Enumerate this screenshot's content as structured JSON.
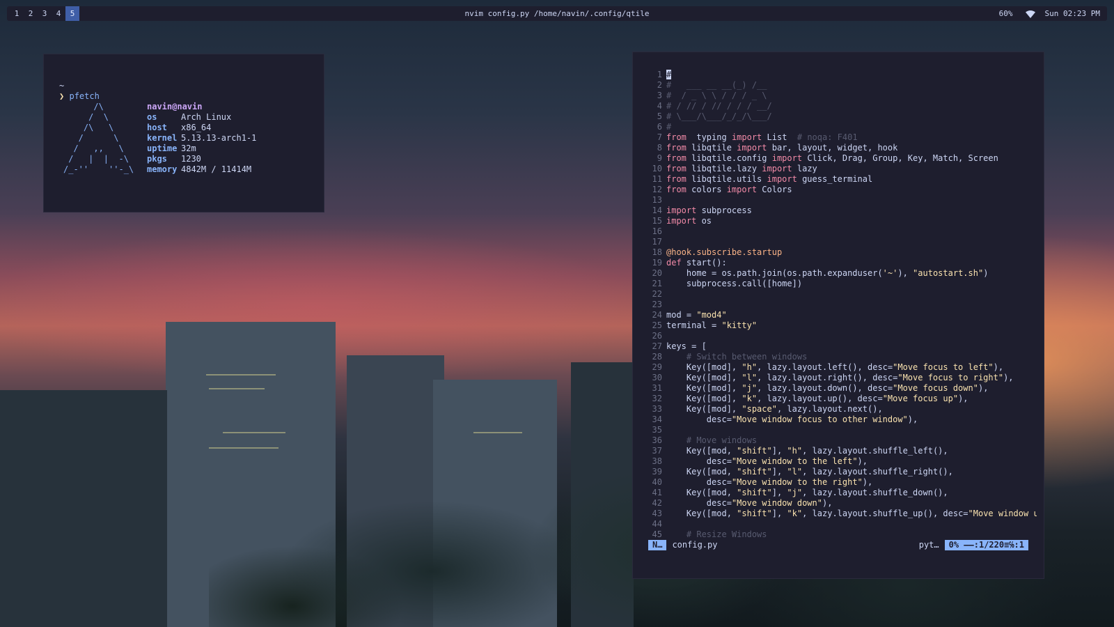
{
  "topbar": {
    "groups": [
      "1",
      "2",
      "3",
      "4",
      "5"
    ],
    "active_group": "5",
    "window_title": "nvim config.py /home/navin/.config/qtile",
    "battery": "60%",
    "clock": "Sun 02:23 PM"
  },
  "terminal": {
    "tilde": "~",
    "prompt_symbol": "❯",
    "command": "pfetch",
    "logo": "      /\\\n     /  \\\n    /\\   \\\n   /      \\\n  /   ,,   \\\n /   |  |  -\\\n/_-''    ''-_\\",
    "user": "navin@navin",
    "info": [
      {
        "key": "os",
        "value": "Arch Linux"
      },
      {
        "key": "host",
        "value": "x86_64"
      },
      {
        "key": "kernel",
        "value": "5.13.13-arch1-1"
      },
      {
        "key": "uptime",
        "value": "32m"
      },
      {
        "key": "pkgs",
        "value": "1230"
      },
      {
        "key": "memory",
        "value": "4842M / 11414M"
      }
    ]
  },
  "editor": {
    "lines": [
      {
        "n": "1",
        "p": [
          [
            "cursor",
            "#"
          ]
        ]
      },
      {
        "n": "2",
        "p": [
          [
            "cm",
            "#   ___ __ __(_) /__"
          ]
        ]
      },
      {
        "n": "3",
        "p": [
          [
            "cm",
            "#  / _ \\ \\ / / / _ \\"
          ]
        ]
      },
      {
        "n": "4",
        "p": [
          [
            "cm",
            "# / // / // / / / __/"
          ]
        ]
      },
      {
        "n": "5",
        "p": [
          [
            "cm",
            "# \\___/\\___/_/_/\\___/"
          ]
        ]
      },
      {
        "n": "6",
        "p": [
          [
            "cm",
            "#"
          ]
        ]
      },
      {
        "n": "7",
        "p": [
          [
            "kw",
            "from"
          ],
          [
            "",
            "  typing "
          ],
          [
            "kw",
            "import"
          ],
          [
            "",
            " List  "
          ],
          [
            "cm",
            "# noqa: F401"
          ]
        ]
      },
      {
        "n": "8",
        "p": [
          [
            "kw",
            "from"
          ],
          [
            "",
            " libqtile "
          ],
          [
            "kw",
            "import"
          ],
          [
            "",
            " bar, layout, widget, hook"
          ]
        ]
      },
      {
        "n": "9",
        "p": [
          [
            "kw",
            "from"
          ],
          [
            "",
            " libqtile.config "
          ],
          [
            "kw",
            "import"
          ],
          [
            "",
            " Click, Drag, Group, Key, Match, Screen"
          ]
        ]
      },
      {
        "n": "10",
        "p": [
          [
            "kw",
            "from"
          ],
          [
            "",
            " libqtile.lazy "
          ],
          [
            "kw",
            "import"
          ],
          [
            "",
            " lazy"
          ]
        ]
      },
      {
        "n": "11",
        "p": [
          [
            "kw",
            "from"
          ],
          [
            "",
            " libqtile.utils "
          ],
          [
            "kw",
            "import"
          ],
          [
            "",
            " guess_terminal"
          ]
        ]
      },
      {
        "n": "12",
        "p": [
          [
            "kw",
            "from"
          ],
          [
            "",
            " colors "
          ],
          [
            "kw",
            "import"
          ],
          [
            "",
            " Colors"
          ]
        ]
      },
      {
        "n": "13",
        "p": []
      },
      {
        "n": "14",
        "p": [
          [
            "kw",
            "import"
          ],
          [
            "",
            " subprocess"
          ]
        ]
      },
      {
        "n": "15",
        "p": [
          [
            "kw",
            "import"
          ],
          [
            "",
            " os"
          ]
        ]
      },
      {
        "n": "16",
        "p": []
      },
      {
        "n": "17",
        "p": []
      },
      {
        "n": "18",
        "p": [
          [
            "dec",
            "@hook.subscribe.startup"
          ]
        ]
      },
      {
        "n": "19",
        "p": [
          [
            "kw",
            "def"
          ],
          [
            "",
            " start():"
          ]
        ]
      },
      {
        "n": "20",
        "p": [
          [
            "",
            "    home = os.path.join(os.path.expanduser("
          ],
          [
            "st",
            "'~'"
          ],
          [
            "",
            "), "
          ],
          [
            "st",
            "\"autostart.sh\""
          ],
          [
            "",
            ")"
          ]
        ]
      },
      {
        "n": "21",
        "p": [
          [
            "",
            "    subprocess.call([home])"
          ]
        ]
      },
      {
        "n": "22",
        "p": []
      },
      {
        "n": "23",
        "p": []
      },
      {
        "n": "24",
        "p": [
          [
            "",
            "mod = "
          ],
          [
            "st",
            "\"mod4\""
          ]
        ]
      },
      {
        "n": "25",
        "p": [
          [
            "",
            "terminal = "
          ],
          [
            "st",
            "\"kitty\""
          ]
        ]
      },
      {
        "n": "26",
        "p": []
      },
      {
        "n": "27",
        "p": [
          [
            "",
            "keys = ["
          ]
        ]
      },
      {
        "n": "28",
        "p": [
          [
            "cm",
            "    # Switch between windows"
          ]
        ]
      },
      {
        "n": "29",
        "p": [
          [
            "",
            "    Key([mod], "
          ],
          [
            "st",
            "\"h\""
          ],
          [
            "",
            ", lazy.layout.left(), desc="
          ],
          [
            "st",
            "\"Move focus to left\""
          ],
          [
            "",
            "),"
          ]
        ]
      },
      {
        "n": "30",
        "p": [
          [
            "",
            "    Key([mod], "
          ],
          [
            "st",
            "\"l\""
          ],
          [
            "",
            ", lazy.layout.right(), desc="
          ],
          [
            "st",
            "\"Move focus to right\""
          ],
          [
            "",
            "),"
          ]
        ]
      },
      {
        "n": "31",
        "p": [
          [
            "",
            "    Key([mod], "
          ],
          [
            "st",
            "\"j\""
          ],
          [
            "",
            ", lazy.layout.down(), desc="
          ],
          [
            "st",
            "\"Move focus down\""
          ],
          [
            "",
            "),"
          ]
        ]
      },
      {
        "n": "32",
        "p": [
          [
            "",
            "    Key([mod], "
          ],
          [
            "st",
            "\"k\""
          ],
          [
            "",
            ", lazy.layout.up(), desc="
          ],
          [
            "st",
            "\"Move focus up\""
          ],
          [
            "",
            "),"
          ]
        ]
      },
      {
        "n": "33",
        "p": [
          [
            "",
            "    Key([mod], "
          ],
          [
            "st",
            "\"space\""
          ],
          [
            "",
            ", lazy.layout.next(),"
          ]
        ]
      },
      {
        "n": "34",
        "p": [
          [
            "",
            "        desc="
          ],
          [
            "st",
            "\"Move window focus to other window\""
          ],
          [
            "",
            "),"
          ]
        ]
      },
      {
        "n": "35",
        "p": []
      },
      {
        "n": "36",
        "p": [
          [
            "cm",
            "    # Move windows"
          ]
        ]
      },
      {
        "n": "37",
        "p": [
          [
            "",
            "    Key([mod, "
          ],
          [
            "st",
            "\"shift\""
          ],
          [
            "",
            "], "
          ],
          [
            "st",
            "\"h\""
          ],
          [
            "",
            ", lazy.layout.shuffle_left(),"
          ]
        ]
      },
      {
        "n": "38",
        "p": [
          [
            "",
            "        desc="
          ],
          [
            "st",
            "\"Move window to the left\""
          ],
          [
            "",
            "),"
          ]
        ]
      },
      {
        "n": "39",
        "p": [
          [
            "",
            "    Key([mod, "
          ],
          [
            "st",
            "\"shift\""
          ],
          [
            "",
            "], "
          ],
          [
            "st",
            "\"l\""
          ],
          [
            "",
            ", lazy.layout.shuffle_right(),"
          ]
        ]
      },
      {
        "n": "40",
        "p": [
          [
            "",
            "        desc="
          ],
          [
            "st",
            "\"Move window to the right\""
          ],
          [
            "",
            "),"
          ]
        ]
      },
      {
        "n": "41",
        "p": [
          [
            "",
            "    Key([mod, "
          ],
          [
            "st",
            "\"shift\""
          ],
          [
            "",
            "], "
          ],
          [
            "st",
            "\"j\""
          ],
          [
            "",
            ", lazy.layout.shuffle_down(),"
          ]
        ]
      },
      {
        "n": "42",
        "p": [
          [
            "",
            "        desc="
          ],
          [
            "st",
            "\"Move window down\""
          ],
          [
            "",
            "),"
          ]
        ]
      },
      {
        "n": "43",
        "p": [
          [
            "",
            "    Key([mod, "
          ],
          [
            "st",
            "\"shift\""
          ],
          [
            "",
            "], "
          ],
          [
            "st",
            "\"k\""
          ],
          [
            "",
            ", lazy.layout.shuffle_up(), desc="
          ],
          [
            "st",
            "\"Move window u"
          ]
        ]
      },
      {
        "n": "44",
        "p": []
      },
      {
        "n": "45",
        "p": [
          [
            "cm",
            "    # Resize Windows"
          ]
        ]
      }
    ],
    "status": {
      "mode": "N…",
      "filename": "config.py",
      "filetype": "pyt…",
      "position": "0% ——:1/220≡℅:1"
    }
  },
  "colors": {
    "bar_bg": "#1e1e2e",
    "active_group": "#3f5ea7",
    "accent_blue": "#89b4fa",
    "keyword": "#f38ba8",
    "string": "#f9e2af",
    "comment": "#585b70"
  }
}
